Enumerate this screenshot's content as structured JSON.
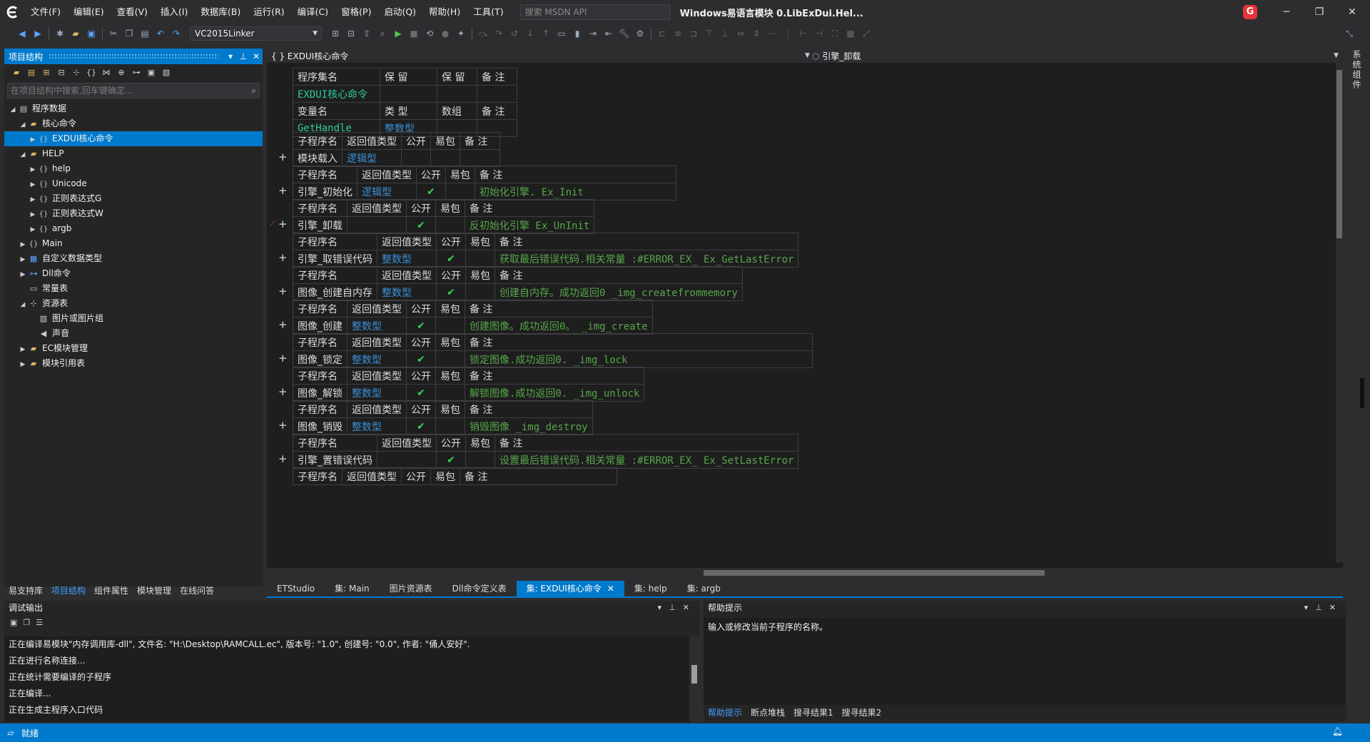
{
  "menubar": {
    "items": [
      "文件(F)",
      "编辑(E)",
      "查看(V)",
      "插入(I)",
      "数据库(B)",
      "运行(R)",
      "编译(C)",
      "窗格(P)",
      "启动(Q)",
      "帮助(H)",
      "工具(T)"
    ],
    "search_placeholder": "搜索 MSDN API",
    "window_title": "Windows易语言模块  0.LibExDui.Hel...",
    "g_label": "G"
  },
  "toolbar": {
    "linker": "VC2015Linker"
  },
  "left_panel": {
    "title": "项目结构",
    "search_placeholder": "在项目结构中搜索,回车键确定...",
    "tree": [
      {
        "label": "程序数据",
        "indent": 0,
        "twisty": "◢",
        "icon": "db"
      },
      {
        "label": "核心命令",
        "indent": 1,
        "twisty": "◢",
        "icon": "folder"
      },
      {
        "label": "EXDUI核心命令",
        "indent": 2,
        "twisty": "▶",
        "icon": "brace",
        "selected": true
      },
      {
        "label": "HELP",
        "indent": 1,
        "twisty": "◢",
        "icon": "folder"
      },
      {
        "label": "help",
        "indent": 2,
        "twisty": "▶",
        "icon": "brace"
      },
      {
        "label": "Unicode",
        "indent": 2,
        "twisty": "▶",
        "icon": "brace"
      },
      {
        "label": "正则表达式G",
        "indent": 2,
        "twisty": "▶",
        "icon": "brace"
      },
      {
        "label": "正则表达式W",
        "indent": 2,
        "twisty": "▶",
        "icon": "brace"
      },
      {
        "label": "argb",
        "indent": 2,
        "twisty": "▶",
        "icon": "brace"
      },
      {
        "label": "Main",
        "indent": 1,
        "twisty": "▶",
        "icon": "brace"
      },
      {
        "label": "自定义数据类型",
        "indent": 1,
        "twisty": "▶",
        "icon": "type"
      },
      {
        "label": "Dll命令",
        "indent": 1,
        "twisty": "▶",
        "icon": "dll"
      },
      {
        "label": "常量表",
        "indent": 1,
        "twisty": "",
        "icon": "const"
      },
      {
        "label": "资源表",
        "indent": 1,
        "twisty": "◢",
        "icon": "res"
      },
      {
        "label": "图片或图片组",
        "indent": 2,
        "twisty": "",
        "icon": "pic"
      },
      {
        "label": "声音",
        "indent": 2,
        "twisty": "",
        "icon": "sound"
      },
      {
        "label": "EC模块管理",
        "indent": 1,
        "twisty": "▶",
        "icon": "folder"
      },
      {
        "label": "模块引用表",
        "indent": 1,
        "twisty": "▶",
        "icon": "folder"
      }
    ],
    "bottom_tabs": [
      "易支持库",
      "项目结构",
      "组件属性",
      "模块管理",
      "在线问答"
    ],
    "active_bottom_tab": 1
  },
  "editor": {
    "header_left": "{ } EXDUI核心命令",
    "header_right": "引擎_卸载",
    "assembly": {
      "headers": [
        "程序集名",
        "保 留",
        "保 留",
        "备 注"
      ],
      "name": "EXDUI核心命令",
      "var_headers": [
        "变量名",
        "类 型",
        "数组",
        "备 注"
      ],
      "var_name": "GetHandle",
      "var_type": "整数型"
    },
    "sub_headers": [
      "子程序名",
      "返回值类型",
      "公开",
      "易包",
      "备 注"
    ],
    "subs": [
      {
        "name": "模块载入",
        "ret": "逻辑型",
        "public": "",
        "note": ""
      },
      {
        "name": "引擎_初始化",
        "ret": "逻辑型",
        "public": "✔",
        "note": "初始化引擎.  Ex_Init"
      },
      {
        "name": "引擎_卸载",
        "ret": "",
        "public": "✔",
        "note": "反初始化引擎  Ex_UnInit"
      },
      {
        "name": "引擎_取错误代码",
        "ret": "整数型",
        "public": "✔",
        "note": "获取最后错误代码.相关常量 :#ERROR_EX_     Ex_GetLastError"
      },
      {
        "name": "图像_创建自内存",
        "ret": "整数型",
        "public": "✔",
        "note": "创建自内存。成功返回0  _img_createfrommemory"
      },
      {
        "name": "图像_创建",
        "ret": "整数型",
        "public": "✔",
        "note": "创建图像。成功返回0。  _img_create"
      },
      {
        "name": "图像_锁定",
        "ret": "整数型",
        "public": "✔",
        "note": "锁定图像.成功返回0.  _img_lock"
      },
      {
        "name": "图像_解锁",
        "ret": "整数型",
        "public": "✔",
        "note": "解锁图像.成功返回0.  _img_unlock"
      },
      {
        "name": "图像_销毁",
        "ret": "整数型",
        "public": "✔",
        "note": "销毁图像  _img_destroy"
      },
      {
        "name": "引擎_置错误代码",
        "ret": "",
        "public": "✔",
        "note": "设置最后错误代码.相关常量 :#ERROR_EX_    Ex_SetLastError"
      }
    ],
    "partial_row": [
      "子程序名",
      "返回值类型",
      "公开",
      "易包",
      "备 注"
    ]
  },
  "side_vertical_tab": "系统组件",
  "doc_tabs": [
    "ETStudio",
    "集: Main",
    "图片资源表",
    "Dll命令定义表",
    "集: EXDUI核心命令",
    "集: help",
    "集: argb"
  ],
  "active_doc_tab": 4,
  "output": {
    "title": "调试输出",
    "lines": [
      "正在编译易模块\"内存调用库-dll\", 文件名: \"H:\\Desktop\\RAMCALL.ec\", 版本号: \"1.0\", 创建号: \"0.0\", 作者: \"俑人安好\".",
      "正在进行名称连接...",
      "正在统计需要编译的子程序",
      "正在编译...",
      "正在生成主程序入口代码"
    ]
  },
  "help": {
    "title": "帮助提示",
    "body": "输入或修改当前子程序的名称。",
    "tabs": [
      "帮助提示",
      "断点堆栈",
      "搜寻结果1",
      "搜寻结果2"
    ],
    "active_tab": 0
  },
  "status": {
    "text": "就绪"
  }
}
